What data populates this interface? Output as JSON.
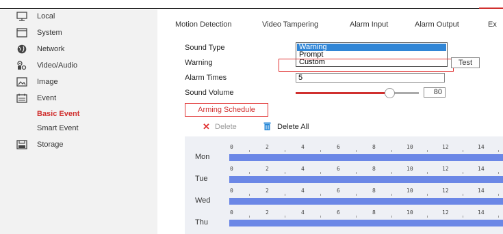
{
  "sidebar": {
    "items": [
      {
        "label": "Local",
        "icon": "monitor-icon"
      },
      {
        "label": "System",
        "icon": "system-icon"
      },
      {
        "label": "Network",
        "icon": "globe-icon"
      },
      {
        "label": "Video/Audio",
        "icon": "video-audio-icon"
      },
      {
        "label": "Image",
        "icon": "image-icon"
      },
      {
        "label": "Event",
        "icon": "calendar-icon"
      }
    ],
    "event_sub": [
      {
        "label": "Basic Event",
        "active": true
      },
      {
        "label": "Smart Event",
        "active": false
      }
    ],
    "storage": {
      "label": "Storage",
      "icon": "storage-icon"
    }
  },
  "tabs": [
    "Motion Detection",
    "Video Tampering",
    "Alarm Input",
    "Alarm Output",
    "Ex"
  ],
  "form": {
    "sound_type_label": "Sound Type",
    "sound_type_options": [
      "Warning",
      "Prompt",
      "Custom"
    ],
    "sound_type_selected": "Warning",
    "warning_label": "Warning",
    "test_label": "Test",
    "alarm_times_label": "Alarm Times",
    "alarm_times_value": "5",
    "sound_volume_label": "Sound Volume",
    "sound_volume_value": "80",
    "sound_volume_level": 80
  },
  "arming_schedule_label": "Arming Schedule",
  "actions": {
    "delete": "Delete",
    "delete_all": "Delete All"
  },
  "schedule": {
    "hours": [
      "0",
      "2",
      "4",
      "6",
      "8",
      "10",
      "12",
      "14"
    ],
    "days": [
      "Mon",
      "Tue",
      "Wed",
      "Thu"
    ]
  },
  "colors": {
    "accent": "#d0302f",
    "schedule_bar": "#6b87e6",
    "selection": "#3186d6"
  }
}
